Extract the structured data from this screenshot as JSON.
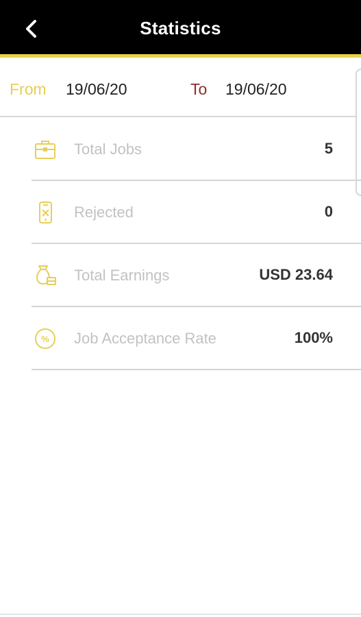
{
  "header": {
    "title": "Statistics",
    "back_icon": "chevron-left-icon",
    "background": "#000000",
    "accent": "#e8d34a"
  },
  "date_range": {
    "from_label": "From",
    "from_value": "19/06/20",
    "to_label": "To",
    "to_value": "19/06/20"
  },
  "stats": [
    {
      "label": "Total Jobs",
      "value": "5",
      "icon": "briefcase-icon"
    },
    {
      "label": "Rejected",
      "value": "0",
      "icon": "phone-rejected-icon"
    },
    {
      "label": "Total Earnings",
      "value": "USD 23.64",
      "icon": "money-bag-icon"
    },
    {
      "label": "Job Acceptance Rate",
      "value": "100%",
      "icon": "percent-circle-icon"
    }
  ],
  "colors": {
    "icon": "#e6cf57",
    "from_label": "#e6cf57",
    "to_label": "#8b2d2d"
  }
}
